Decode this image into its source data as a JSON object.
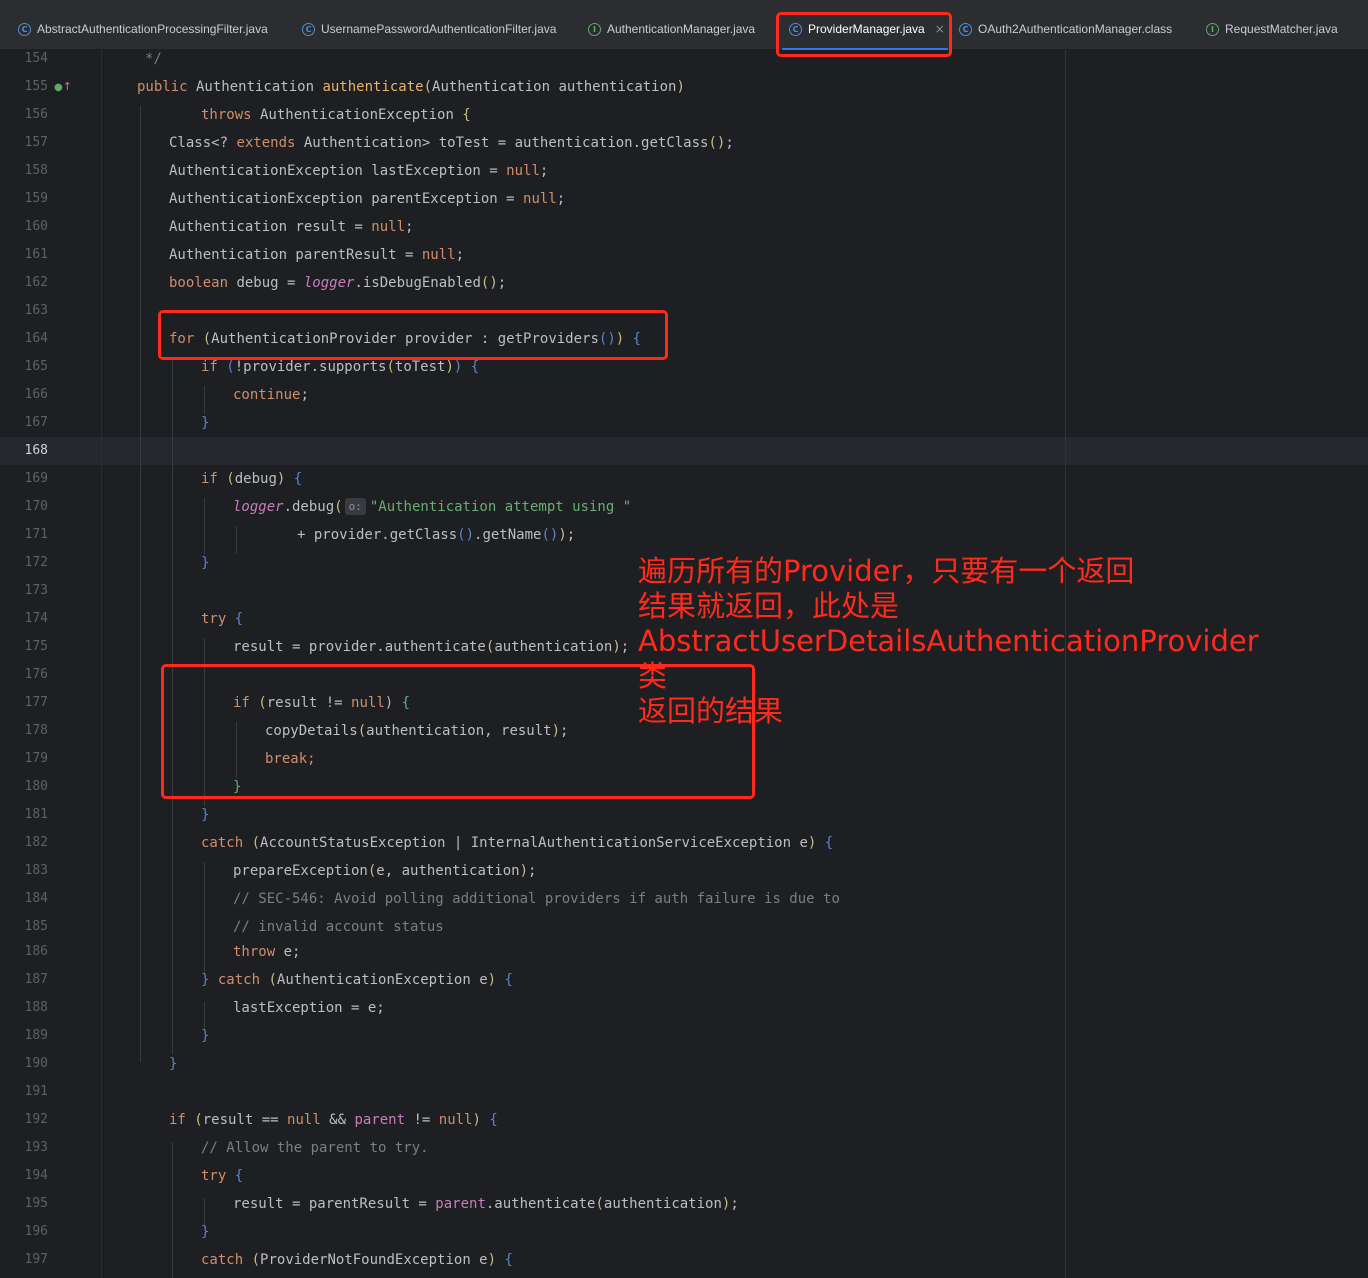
{
  "tabs": [
    {
      "label": "AbstractAuthenticationProcessingFilter.java",
      "kind": "class",
      "active": false
    },
    {
      "label": "UsernamePasswordAuthenticationFilter.java",
      "kind": "class",
      "active": false
    },
    {
      "label": "AuthenticationManager.java",
      "kind": "interface",
      "active": false
    },
    {
      "label": "ProviderManager.java",
      "kind": "class",
      "active": true,
      "close": "×"
    },
    {
      "label": "OAuth2AuthenticationManager.class",
      "kind": "class",
      "active": false
    },
    {
      "label": "RequestMatcher.java",
      "kind": "interface",
      "active": false
    }
  ],
  "editor": {
    "current_line": "168",
    "line_numbers": [
      "154",
      "155",
      "156",
      "157",
      "158",
      "159",
      "160",
      "161",
      "162",
      "163",
      "164",
      "165",
      "166",
      "167",
      "168",
      "169",
      "170",
      "171",
      "172",
      "173",
      "174",
      "175",
      "176",
      "177",
      "178",
      "179",
      "180",
      "181",
      "182",
      "183",
      "184",
      "185",
      "186",
      "187",
      "188",
      "189",
      "190",
      "191",
      "192",
      "193",
      "194",
      "195",
      "196",
      "197"
    ],
    "code_lines": [
      "*/",
      "public Authentication authenticate(Authentication authentication)",
      "throws AuthenticationException {",
      "Class<? extends Authentication> toTest = authentication.getClass();",
      "AuthenticationException lastException = null;",
      "AuthenticationException parentException = null;",
      "Authentication result = null;",
      "Authentication parentResult = null;",
      "boolean debug = logger.isDebugEnabled();",
      "",
      "for (AuthenticationProvider provider : getProviders()) {",
      "if (!provider.supports(toTest)) {",
      "continue;",
      "}",
      "",
      "if (debug) {",
      "logger.debug( o: \"Authentication attempt using \"",
      "+ provider.getClass().getName());",
      "}",
      "",
      "try {",
      "result = provider.authenticate(authentication);",
      "",
      "if (result != null) {",
      "copyDetails(authentication, result);",
      "break;",
      "}",
      "}",
      "catch (AccountStatusException | InternalAuthenticationServiceException e) {",
      "prepareException(e, authentication);",
      "// SEC-546: Avoid polling additional providers if auth failure is due to",
      "// invalid account status",
      "throw e;",
      "} catch (AuthenticationException e) {",
      "lastException = e;",
      "}",
      "}",
      "",
      "if (result == null && parent != null) {",
      "// Allow the parent to try.",
      "try {",
      "result = parentResult = parent.authenticate(authentication);",
      "}",
      "catch (ProviderNotFoundException e) {"
    ],
    "param_hint": "o:",
    "gutter_icons": [
      "implementing-method-icon",
      "override-up-arrow-icon"
    ]
  },
  "annotation": {
    "note": "遍历所有的Provider，只要有一个返回\n结果就返回，此处是\nAbstractUserDetailsAuthenticationProvider类\n返回的结果",
    "color": "#ff2a1c"
  },
  "colors": {
    "keyword": "#cf8e6d",
    "method": "#56a8f5",
    "field": "#c77dbb",
    "string": "#6aab73",
    "comment": "#7a7e85",
    "highlight": "#ff2a1c",
    "background": "#1e1f22"
  }
}
